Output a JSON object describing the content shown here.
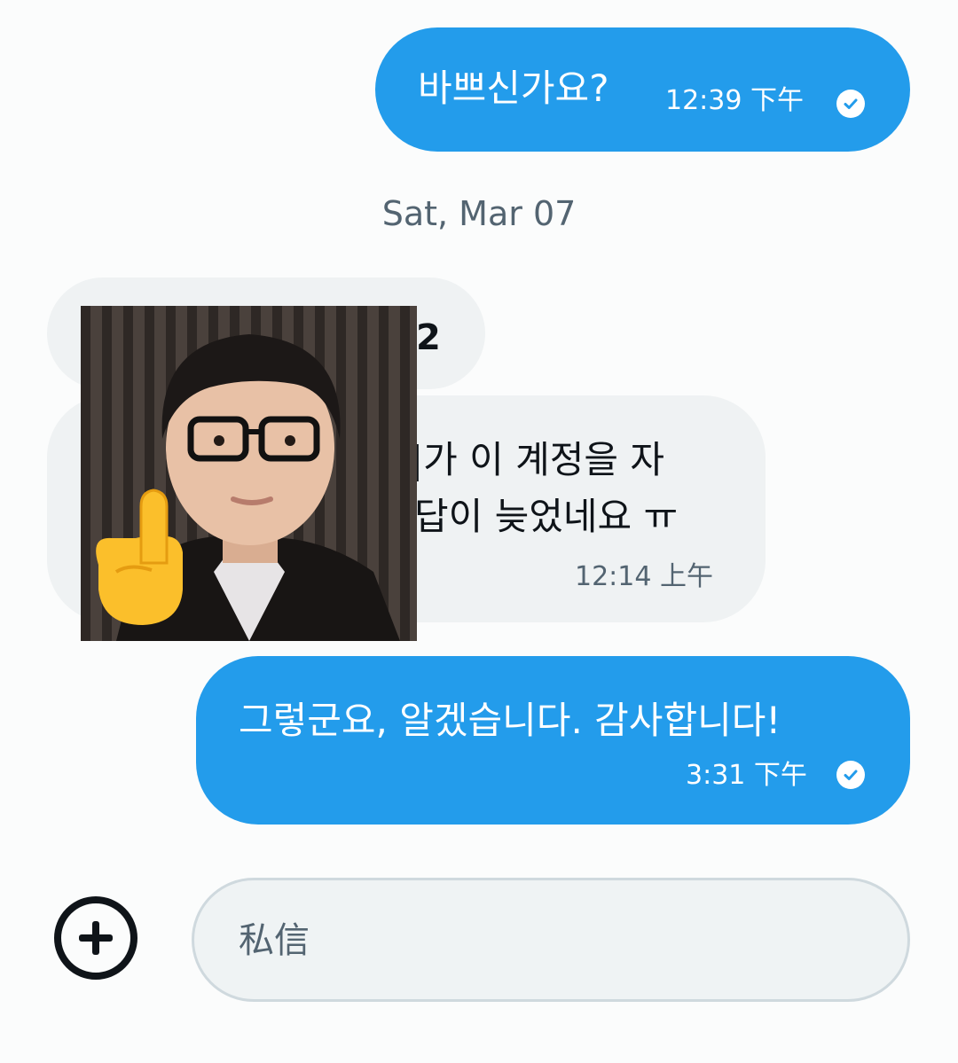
{
  "messages": [
    {
      "direction": "out",
      "text": "바쁘신가요?",
      "time": "12:39 下午",
      "status_icon": "check-circle-icon"
    },
    {
      "direction": "in",
      "text": "2"
    },
    {
      "direction": "in",
      "lines": [
        "|가 이 계정을 자",
        "답이 늦었네요 ㅠ"
      ],
      "time": "12:14 上午"
    },
    {
      "direction": "out",
      "text": "그렇군요, 알겠습니다. 감사합니다!",
      "time": "3:31 下午",
      "status_icon": "check-circle-icon"
    }
  ],
  "date_separator": "Sat, Mar 07",
  "sticker": {
    "emoji": "☝️"
  },
  "composer": {
    "placeholder": "私信",
    "value": "",
    "add_icon": "plus-circle-icon"
  },
  "colors": {
    "outgoing_bubble": "#239ceb",
    "incoming_bubble": "#eff2f3",
    "secondary_text": "#536471"
  }
}
